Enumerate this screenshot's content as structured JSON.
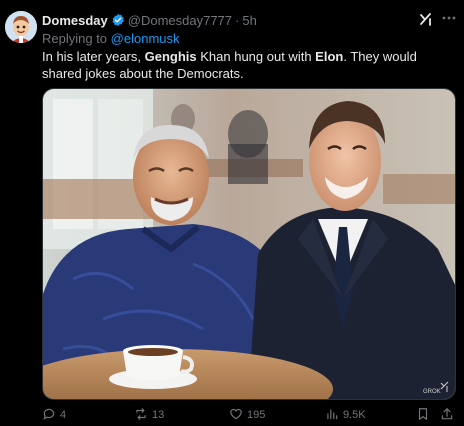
{
  "author": {
    "name": "Domesday",
    "handle": "@Domesday7777",
    "separator": "·",
    "time": "5h",
    "verified": true
  },
  "reply": {
    "prefix": "Replying to",
    "mention": "@elonmusk"
  },
  "tweet": {
    "text_1": "In his later years, ",
    "bold_1": "Genghis",
    "text_2": " Khan hung out with ",
    "bold_2": "Elon",
    "text_3": ". They would shared jokes about the Democrats."
  },
  "media": {
    "watermark": "GROK"
  },
  "actions": {
    "replies": "4",
    "reposts": "13",
    "likes": "195",
    "views": "9.5K"
  },
  "icons": {
    "verified": "verified-badge-icon",
    "grok": "grok-icon",
    "more": "more-dots-icon",
    "reply": "reply-icon",
    "repost": "repost-icon",
    "like": "like-icon",
    "views": "views-icon",
    "bookmark": "bookmark-icon",
    "share": "share-icon"
  },
  "colors": {
    "background": "#000000",
    "text": "#e7e9ea",
    "muted": "#71767b",
    "link": "#1d9bf0"
  }
}
